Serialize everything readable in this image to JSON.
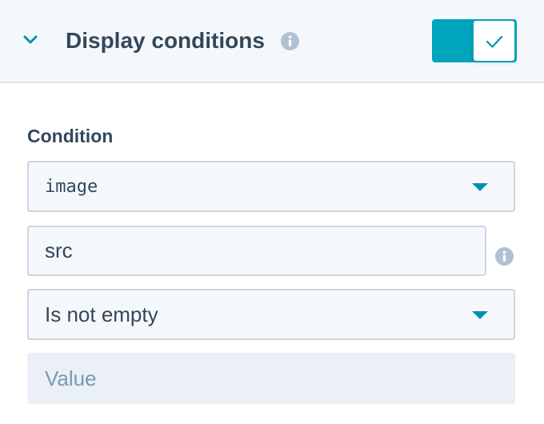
{
  "header": {
    "title": "Display conditions",
    "toggle_on": true
  },
  "condition": {
    "label": "Condition",
    "property_select": "image",
    "field_input": "src",
    "operator_select": "Is not empty",
    "value_placeholder": "Value"
  },
  "colors": {
    "accent": "#00a4bd",
    "caret": "#0091ae",
    "text": "#33475b",
    "header_bg": "#f5f8fa",
    "border": "#cbd6e2",
    "disabled_bg": "#eaf0f6",
    "placeholder": "#7c98b6",
    "info_icon": "#b0c1d4"
  },
  "icons": {
    "collapse": "chevron-down-icon",
    "info": "info-icon",
    "toggle_check": "check-icon",
    "dropdown": "caret-down-icon"
  }
}
